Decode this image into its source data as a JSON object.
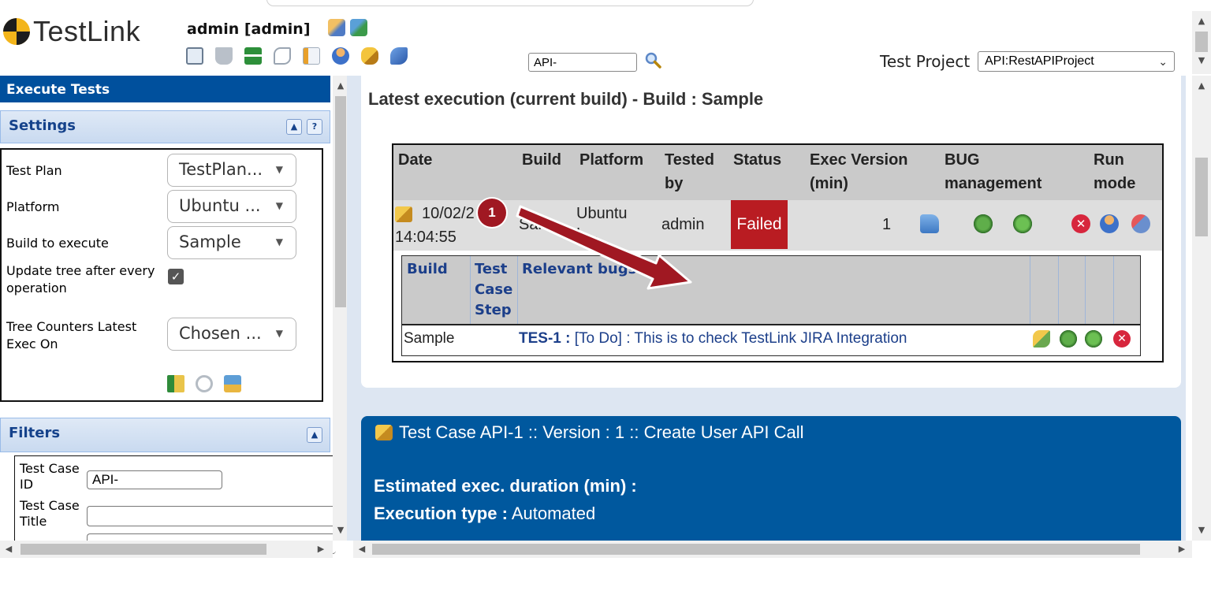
{
  "header": {
    "logo_text": "TestLink",
    "user": "admin [admin]",
    "tc_search_value": "API-",
    "project_label": "Test Project",
    "project_selected": "API:RestAPIProject"
  },
  "left": {
    "title": "Execute Tests",
    "settings_title": "Settings",
    "settings": {
      "test_plan_label": "Test Plan",
      "test_plan_value": "TestPlan...",
      "platform_label": "Platform",
      "platform_value": "Ubuntu ...",
      "build_label": "Build to execute",
      "build_value": "Sample",
      "update_tree_label_1": "Update tree after every",
      "update_tree_label_2": "operation",
      "tree_counters_label_1": "Tree Counters Latest",
      "tree_counters_label_2": "Exec On",
      "tree_counters_value": "Chosen ..."
    },
    "filters_title": "Filters",
    "filters": {
      "tc_id_label_1": "Test Case",
      "tc_id_label_2": "ID",
      "tc_id_value": "API-",
      "tc_title_label_1": "Test Case",
      "tc_title_label_2": "Title"
    }
  },
  "main": {
    "latest_title": "Latest execution (current build) - Build : Sample",
    "table_headers": {
      "date": "Date",
      "build": "Build",
      "platform": "Platform",
      "tested_by_1": "Tested",
      "tested_by_2": "by",
      "status": "Status",
      "exec_version_1": "Exec Version",
      "exec_version_2": "(min)",
      "bug_1": "BUG",
      "bug_2": "management",
      "run_1": "Run",
      "run_2": "mode"
    },
    "row": {
      "date_1": "10/02/2",
      "date_2": "14:04:55",
      "build": "Samp",
      "platform_1": "Ubuntu",
      "platform_2": "L...",
      "tested_by": "admin",
      "status": "Failed",
      "version": "1"
    },
    "bug_headers": {
      "build": "Build",
      "step_1": "Test",
      "step_2": "Case",
      "step_3": "Step",
      "bugs": "Relevant bugs"
    },
    "bug_row": {
      "build": "Sample",
      "bug_id": "TES-1 :",
      "bug_text": "[To Do] : This is to check TestLink JIRA Integration"
    },
    "testcase": {
      "title": "Test Case API-1 :: Version : 1 :: Create User API Call",
      "duration_label": "Estimated exec. duration (min) :",
      "exec_type_label": "Execution type :",
      "exec_type_value": "Automated"
    }
  },
  "callout": {
    "number": "1"
  },
  "colors": {
    "brand_blue": "#00509d",
    "failed_red": "#b91c22",
    "arrow_red": "#a01822",
    "link_blue": "#1c3f8a"
  }
}
